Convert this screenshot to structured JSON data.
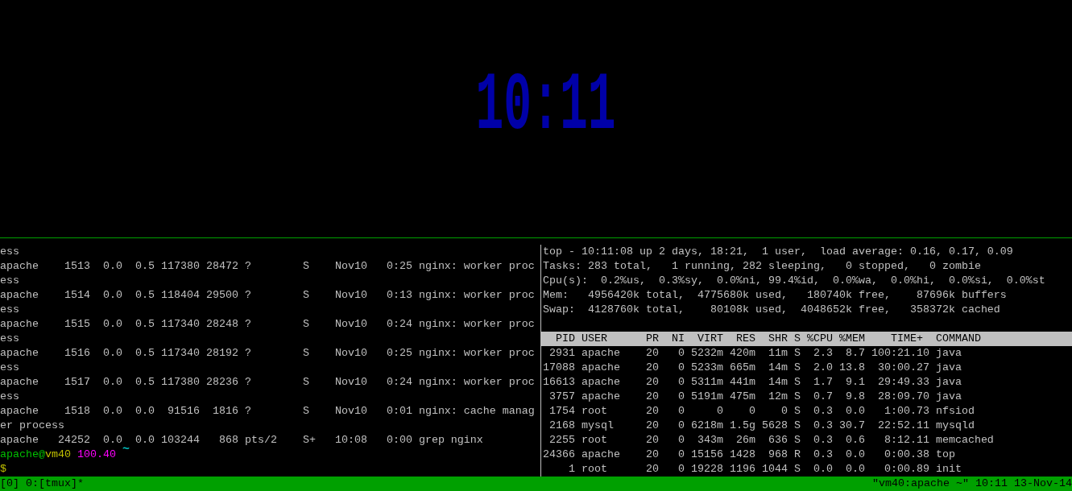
{
  "clock": {
    "time": "10:11"
  },
  "left_pane": {
    "lines": [
      "ess",
      "apache    1513  0.0  0.5 117380 28472 ?        S    Nov10   0:25 nginx: worker proc",
      "ess",
      "apache    1514  0.0  0.5 118404 29500 ?        S    Nov10   0:13 nginx: worker proc",
      "ess",
      "apache    1515  0.0  0.5 117340 28248 ?        S    Nov10   0:24 nginx: worker proc",
      "ess",
      "apache    1516  0.0  0.5 117340 28192 ?        S    Nov10   0:25 nginx: worker proc",
      "ess",
      "apache    1517  0.0  0.5 117380 28236 ?        S    Nov10   0:24 nginx: worker proc",
      "ess",
      "apache    1518  0.0  0.0  91516  1816 ?        S    Nov10   0:01 nginx: cache manag",
      "er process",
      "apache   24252  0.0  0.0 103244   868 pts/2    S+   10:08   0:00 grep nginx"
    ],
    "prompt": {
      "user_host": [
        {
          "text": "apache@",
          "color": "#00c000"
        },
        {
          "text": "vm40",
          "color": "#c0c000"
        }
      ],
      "path": {
        "text": "100.40",
        "color": "#ff00ff"
      },
      "marker": {
        "text": "~",
        "color": "#00c0c0"
      }
    },
    "input_line": {
      "text": "$",
      "color": "#c0c000"
    }
  },
  "right_pane": {
    "summary_lines": [
      "top - 10:11:08 up 2 days, 18:21,  1 user,  load average: 0.16, 0.17, 0.09",
      "Tasks: 283 total,   1 running, 282 sleeping,   0 stopped,   0 zombie",
      "Cpu(s):  0.2%us,  0.3%sy,  0.0%ni, 99.4%id,  0.0%wa,  0.0%hi,  0.0%si,  0.0%st",
      "Mem:   4956420k total,  4775680k used,   180740k free,    87696k buffers",
      "Swap:  4128760k total,    80108k used,  4048652k free,   358372k cached"
    ],
    "header": "  PID USER      PR  NI  VIRT  RES  SHR S %CPU %MEM    TIME+  COMMAND",
    "process_rows": [
      " 2931 apache    20   0 5232m 420m  11m S  2.3  8.7 100:21.10 java",
      "17088 apache    20   0 5233m 665m  14m S  2.0 13.8  30:00.27 java",
      "16613 apache    20   0 5311m 441m  14m S  1.7  9.1  29:49.33 java",
      " 3757 apache    20   0 5191m 475m  12m S  0.7  9.8  28:09.70 java",
      " 1754 root      20   0     0    0    0 S  0.3  0.0   1:00.73 nfsiod",
      " 2168 mysql     20   0 6218m 1.5g 5628 S  0.3 30.7  22:52.11 mysqld",
      " 2255 root      20   0  343m  26m  636 S  0.3  0.6   8:12.11 memcached",
      "24366 apache    20   0 15156 1428  968 R  0.3  0.0   0:00.38 top",
      "    1 root      20   0 19228 1196 1044 S  0.0  0.0   0:00.89 init"
    ]
  },
  "status_bar": {
    "left": "[0] 0:[tmux]*",
    "right": "\"vm40:apache ~\" 10:11 13-Nov-14"
  }
}
